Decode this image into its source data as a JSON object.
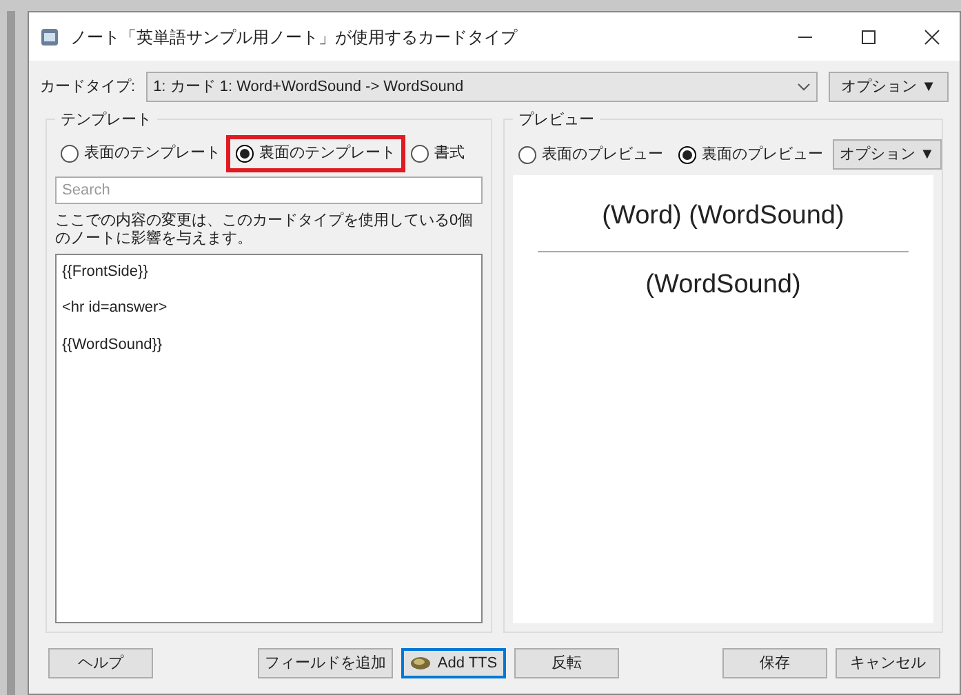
{
  "window": {
    "title": "ノート「英単語サンプル用ノート」が使用するカードタイプ"
  },
  "card_type": {
    "label": "カードタイプ:",
    "value": "1: カード 1: Word+WordSound -> WordSound",
    "options_button": "オプション ▼"
  },
  "template": {
    "title": "テンプレート",
    "options": [
      {
        "label": "表面のテンプレート",
        "selected": false,
        "highlighted": false
      },
      {
        "label": "裏面のテンプレート",
        "selected": true,
        "highlighted": true
      },
      {
        "label": "書式",
        "selected": false,
        "highlighted": false
      }
    ],
    "search": {
      "placeholder": "Search"
    },
    "notice": "ここでの内容の変更は、このカードタイプを使用している0個のノートに影響を与えます。",
    "lines": [
      "{{FrontSide}}",
      "<hr id=answer>",
      "{{WordSound}}"
    ]
  },
  "preview": {
    "title": "プレビュー",
    "options": [
      {
        "label": "表面のプレビュー",
        "selected": false
      },
      {
        "label": "裏面のプレビュー",
        "selected": true
      }
    ],
    "options_button": "オプション ▼",
    "question": "(Word) (WordSound)",
    "answer": "(WordSound)"
  },
  "buttons": {
    "left": [
      {
        "label": "ヘルプ",
        "focused": false,
        "kind": "text"
      }
    ],
    "middle": [
      {
        "label": "フィールドを追加",
        "focused": false,
        "kind": "text"
      },
      {
        "label": "Add TTS",
        "focused": true,
        "kind": "icon"
      },
      {
        "label": "反転",
        "focused": false,
        "kind": "text"
      }
    ],
    "right": [
      {
        "label": "保存",
        "focused": false,
        "kind": "text"
      },
      {
        "label": "キャンセル",
        "focused": false,
        "kind": "text"
      }
    ]
  }
}
